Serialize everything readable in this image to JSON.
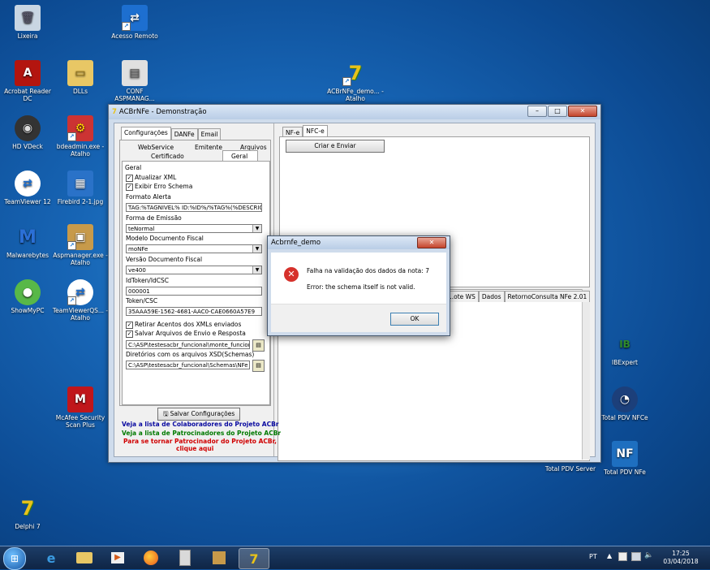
{
  "desktop": {
    "icons": [
      {
        "label": "Lixeira",
        "glyph": "🗑"
      },
      {
        "label": "Acesso Remoto",
        "glyph": "⇄"
      },
      {
        "label": "Acrobat Reader DC",
        "glyph": "A"
      },
      {
        "label": "DLLs",
        "glyph": "📁"
      },
      {
        "label": "CONF ASPMANAG...",
        "glyph": "▤"
      },
      {
        "label": "ACBrNFe_demo... - Atalho",
        "glyph": "7"
      },
      {
        "label": "HD VDeck",
        "glyph": "◉"
      },
      {
        "label": "bdeadmin.exe - Atalho",
        "glyph": "⚙"
      },
      {
        "label": "TeamViewer 12",
        "glyph": "⇄"
      },
      {
        "label": "Firebird 2-1.jpg",
        "glyph": "▦"
      },
      {
        "label": "Malwarebytes",
        "glyph": "M"
      },
      {
        "label": "Aspmanager.exe - Atalho",
        "glyph": "▣"
      },
      {
        "label": "ShowMyPC",
        "glyph": "●"
      },
      {
        "label": "TeamViewerQS... - Atalho",
        "glyph": "⇄"
      },
      {
        "label": "IBExpert",
        "glyph": "IB"
      },
      {
        "label": "McAfee Security Scan Plus",
        "glyph": "M"
      },
      {
        "label": "Total PDV NFCe",
        "glyph": "◔"
      },
      {
        "label": "Total PDV Server",
        "glyph": ""
      },
      {
        "label": "Total PDV NFe",
        "glyph": "NF"
      },
      {
        "label": "Delphi 7",
        "glyph": "7"
      }
    ]
  },
  "window": {
    "title": "ACBrNFe - Demonstração",
    "tabs_top": [
      "Configurações",
      "DANFe",
      "Email"
    ],
    "tabs_row2": [
      "WebService",
      "Emitente",
      "Arquivos"
    ],
    "tabs_row3": [
      "Certificado",
      "Geral"
    ],
    "group_title": "Geral",
    "chk_atualizar": "Atualizar XML",
    "chk_exibir": "Exibir Erro Schema",
    "lbl_formato": "Formato Alerta",
    "formato_value": "TAG:%TAGNIVEL% ID:%ID%/%TAG%(%DESCRICAO%)",
    "lbl_forma": "Forma de Emissão",
    "forma_value": "teNormal",
    "lbl_modelo": "Modelo Documento Fiscal",
    "modelo_value": "moNFe",
    "lbl_versao": "Versão Documento Fiscal",
    "versao_value": "ve400",
    "lbl_idtoken": "IdToken/IdCSC",
    "idtoken_value": "000001",
    "lbl_token": "Token/CSC",
    "token_value": "35AAA59E-1562-4681-AAC0-CAE0660A57E9",
    "chk_retirar": "Retirar Acentos dos XMLs enviados",
    "chk_salvar": "Salvar Arquivos de Envio e Resposta",
    "path1": "C:\\ASP\\testesacbr_funcional\\monte_funcional_",
    "lbl_dir": "Diretórios com os arquivos XSD(Schemas)",
    "path2": "C:\\ASP\\testesacbr_funcional\\Schemas\\NFe",
    "save_btn": "Salvar Configurações",
    "link1": "Veja a lista de Colaboradores do Projeto ACBr",
    "link2": "Veja a lista de Patrocinadores do Projeto ACBr",
    "link3a": "Para se tornar Patrocinador do Projeto ACBr,",
    "link3b": "clique aqui",
    "right_tabs": [
      "NF-e",
      "NFC-e"
    ],
    "criar_btn": "Criar e Enviar",
    "result_tabs": [
      "...ote WS",
      "Dados",
      "RetornoConsulta NFe 2.01"
    ]
  },
  "dialog": {
    "title": "Acbrnfe_demo",
    "line1": "Falha na validação dos dados da nota: 7",
    "line2": "Error: the schema itself is not valid.",
    "ok": "OK"
  },
  "taskbar": {
    "lang": "PT",
    "time": "17:25",
    "date": "03/04/2018"
  },
  "colors": {
    "link_blue": "#0a0aa0",
    "link_green": "#007a00",
    "link_red": "#d00000",
    "error_red": "#d6312b"
  }
}
